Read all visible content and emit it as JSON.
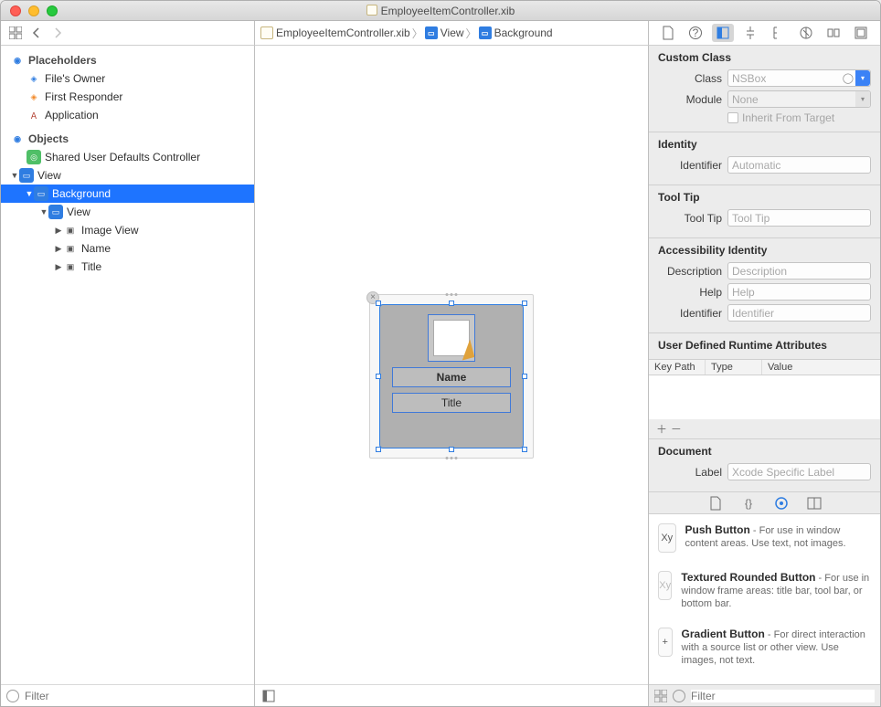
{
  "title": "EmployeeItemController.xib",
  "crumbs": {
    "file": "EmployeeItemController.xib",
    "view": "View",
    "bg": "Background"
  },
  "outline": {
    "placeholders": "Placeholders",
    "filesOwner": "File's Owner",
    "firstResponder": "First Responder",
    "application": "Application",
    "objects": "Objects",
    "sudc": "Shared User Defaults Controller",
    "view": "View",
    "background": "Background",
    "innerView": "View",
    "imageView": "Image View",
    "name": "Name",
    "titleItem": "Title"
  },
  "canvas": {
    "name": "Name",
    "title": "Title"
  },
  "inspector": {
    "customClass": {
      "heading": "Custom Class",
      "classLabel": "Class",
      "classValue": "NSBox",
      "moduleLabel": "Module",
      "moduleValue": "None",
      "inherit": "Inherit From Target"
    },
    "identity": {
      "heading": "Identity",
      "identifierLabel": "Identifier",
      "identifierPh": "Automatic"
    },
    "tooltip": {
      "heading": "Tool Tip",
      "label": "Tool Tip",
      "ph": "Tool Tip"
    },
    "ax": {
      "heading": "Accessibility Identity",
      "descLabel": "Description",
      "descPh": "Description",
      "helpLabel": "Help",
      "helpPh": "Help",
      "idLabel": "Identifier",
      "idPh": "Identifier"
    },
    "udra": {
      "heading": "User Defined Runtime Attributes",
      "keypath": "Key Path",
      "type": "Type",
      "value": "Value"
    },
    "doc": {
      "heading": "Document",
      "labelLabel": "Label",
      "labelPh": "Xcode Specific Label"
    }
  },
  "library": {
    "items": [
      {
        "icon": "Xy",
        "name": "Push Button",
        "desc": "For use in window content areas. Use text, not images."
      },
      {
        "icon": "Xy",
        "name": "Textured Rounded Button",
        "desc": "For use in window frame areas: title bar, tool bar, or bottom bar."
      },
      {
        "icon": "+",
        "name": "Gradient Button",
        "desc": "For direct interaction with a source list or other view. Use images, not text."
      }
    ]
  },
  "filterPlaceholder": "Filter"
}
